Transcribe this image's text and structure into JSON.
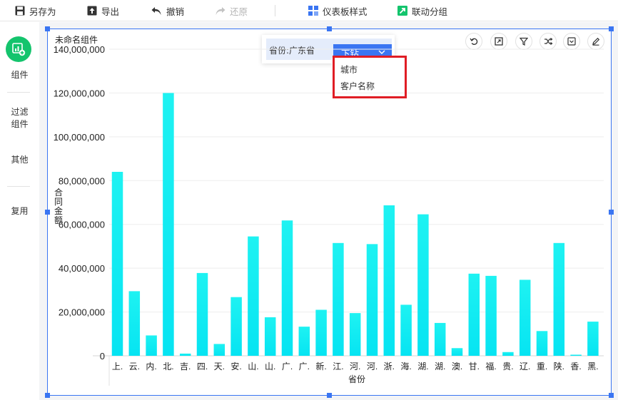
{
  "toolbar": {
    "save_as": "另存为",
    "export": "导出",
    "undo": "撤销",
    "redo": "还原",
    "dashboard_style": "仪表板样式",
    "link_group": "联动分组"
  },
  "sidebar": {
    "items": [
      "组件",
      "过滤\n组件",
      "其他",
      "复用"
    ]
  },
  "widget": {
    "title": "未命名组件",
    "drill": {
      "breadcrumb": "省份:广东省",
      "button_label": "下钻",
      "options": [
        "城市",
        "客户名称"
      ]
    }
  },
  "colors": {
    "accent": "#3a75f2",
    "bar_top": "#1ef2f2",
    "bar_bottom": "#06e4f2",
    "highlight_box": "#e01d25",
    "add_button": "#14c46d"
  },
  "chart_data": {
    "type": "bar",
    "xlabel": "省份",
    "ylabel": "合同金额",
    "ylim": [
      0,
      140000000
    ],
    "yticks": [
      "0",
      "20,000,000",
      "40,000,000",
      "60,000,000",
      "80,000,000",
      "100,000,000",
      "120,000,000",
      "140,000,000"
    ],
    "categories": [
      "上.",
      "云.",
      "内.",
      "北.",
      "吉.",
      "四.",
      "天.",
      "安.",
      "山.",
      "山.",
      "广.",
      "广.",
      "新.",
      "江.",
      "河.",
      "河.",
      "浙.",
      "海.",
      "湖.",
      "湖.",
      "澳.",
      "甘.",
      "福.",
      "贵.",
      "辽.",
      "重.",
      "陕.",
      "香.",
      "黑."
    ],
    "values": [
      84000000,
      29500000,
      9300000,
      120000000,
      1000000,
      37800000,
      5400000,
      26800000,
      54500000,
      17600000,
      61800000,
      13300000,
      21000000,
      51500000,
      19500000,
      51000000,
      68700000,
      23300000,
      64600000,
      15000000,
      3500000,
      37500000,
      36500000,
      1700000,
      34700000,
      11300000,
      51500000,
      500000,
      15600000
    ],
    "grid": true,
    "legend": "none"
  }
}
